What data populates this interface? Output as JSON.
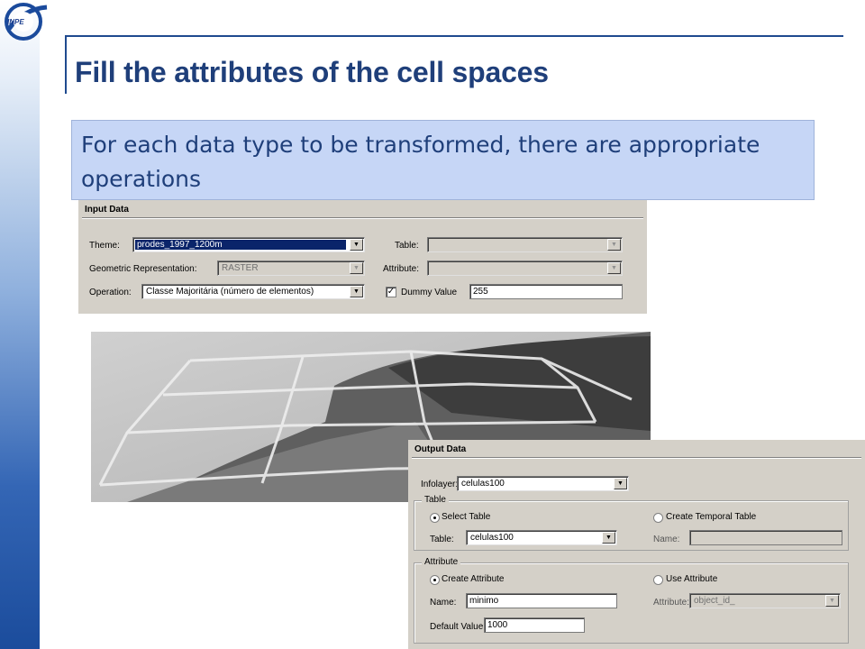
{
  "logo": {
    "text": "INPE",
    "icon": "inpe-logo-icon"
  },
  "slide": {
    "title": "Fill the attributes of the cell spaces",
    "callout": "For each data type to be transformed, there are appropriate operations"
  },
  "input_panel": {
    "header": "Input Data",
    "theme_label": "Theme:",
    "theme_value": "prodes_1997_1200m",
    "georep_label": "Geometric Representation:",
    "georep_value": "RASTER",
    "operation_label": "Operation:",
    "operation_value": "Classe Majoritária (número de elementos)",
    "table_label": "Table:",
    "table_value": "",
    "attribute_label": "Attribute:",
    "attribute_value": "",
    "dummy_label": "Dummy Value",
    "dummy_checked": true,
    "dummy_value": "255"
  },
  "output_panel": {
    "header": "Output Data",
    "infolayer_label": "Infolayer:",
    "infolayer_value": "celulas100",
    "table_group": {
      "label": "Table",
      "select_table": "Select Table",
      "create_temporal": "Create Temporal Table",
      "table_label": "Table:",
      "table_value": "celulas100",
      "name_label": "Name:",
      "name_value": ""
    },
    "attribute_group": {
      "label": "Attribute",
      "create_attribute": "Create Attribute",
      "use_attribute": "Use Attribute",
      "name_label": "Name:",
      "name_value": "minimo",
      "attribute_label": "Attribute:",
      "attribute_value": "object_id_",
      "default_label": "Default Value:",
      "default_value": "1000"
    }
  },
  "colors": {
    "title": "#1f3f7a",
    "callout_bg": "#c6d6f6",
    "panel_bg": "#d4d0c8",
    "selection": "#0a246a"
  }
}
